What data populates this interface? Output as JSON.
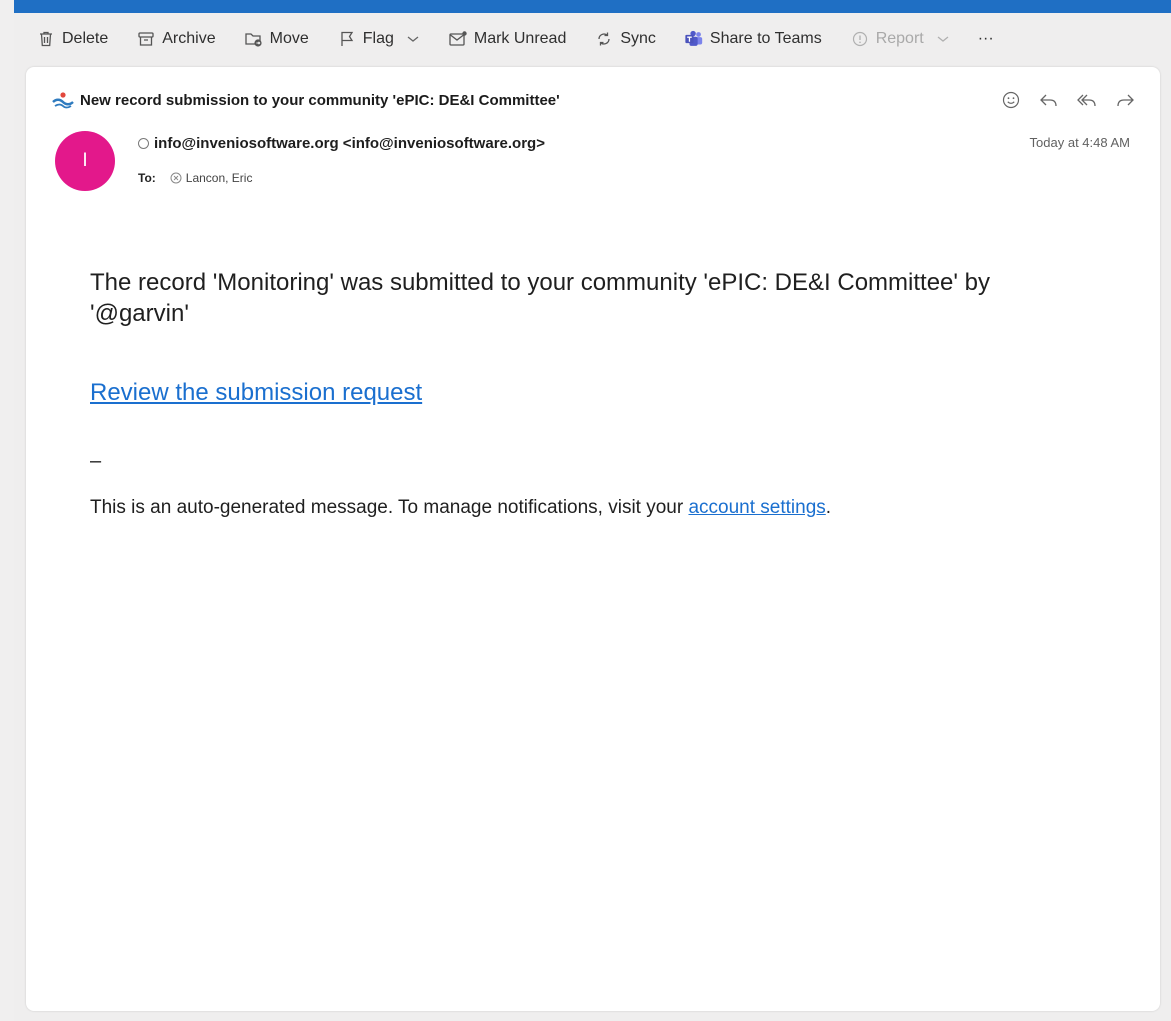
{
  "toolbar": {
    "delete": "Delete",
    "archive": "Archive",
    "move": "Move",
    "flag": "Flag",
    "mark_unread": "Mark Unread",
    "sync": "Sync",
    "share_teams": "Share to Teams",
    "report": "Report",
    "more": "···"
  },
  "message": {
    "subject": "New record submission to your community 'ePIC: DE&I Committee'",
    "avatar_letter": "I",
    "sender": "info@inveniosoftware.org <info@inveniosoftware.org>",
    "timestamp": "Today at 4:48 AM",
    "to_label": "To:",
    "recipient": "Lancon, Eric",
    "body": "The record 'Monitoring' was submitted to your community 'ePIC: DE&I Committee' by '@garvin'",
    "review_link": "Review the submission request",
    "separator": "–",
    "footer_text": "This is an auto-generated message. To manage notifications, visit your ",
    "footer_link": "account settings",
    "footer_end": "."
  },
  "colors": {
    "accent": "#1f6fc4",
    "avatar": "#e3188b",
    "link": "#1a6fcf"
  }
}
